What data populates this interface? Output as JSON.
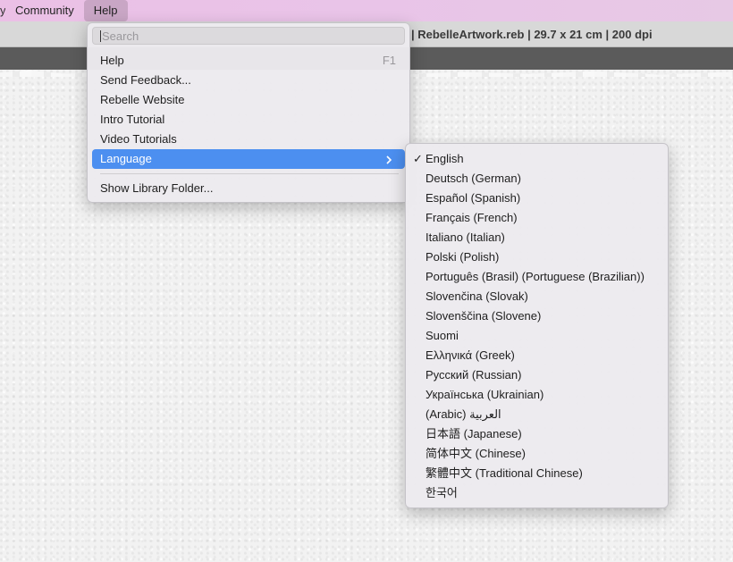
{
  "menubar": {
    "items": [
      {
        "label": "Community"
      },
      {
        "label": "Help"
      }
    ]
  },
  "window": {
    "title": "| RebelleArtwork.reb | 29.7 x 21 cm | 200 dpi"
  },
  "help_menu": {
    "search_placeholder": "Search",
    "items": [
      {
        "label": "Help",
        "shortcut": "F1"
      },
      {
        "label": "Send Feedback..."
      },
      {
        "label": "Rebelle Website"
      },
      {
        "label": "Intro Tutorial"
      },
      {
        "label": "Video Tutorials"
      },
      {
        "label": "Language",
        "submenu_icon": "chevron-right-icon"
      },
      {
        "label": "Show Library Folder..."
      }
    ]
  },
  "language_menu": {
    "checked_icon": "checkmark-icon",
    "items": [
      {
        "label": "English",
        "checked": true
      },
      {
        "label": "Deutsch (German)"
      },
      {
        "label": "Español (Spanish)"
      },
      {
        "label": "Français (French)"
      },
      {
        "label": "Italiano (Italian)"
      },
      {
        "label": "Polski (Polish)"
      },
      {
        "label": "Português (Brasil) (Portuguese (Brazilian))"
      },
      {
        "label": "Slovenčina (Slovak)"
      },
      {
        "label": "Slovenščina (Slovene)"
      },
      {
        "label": "Suomi"
      },
      {
        "label": "Ελληνικά (Greek)"
      },
      {
        "label": "Русский (Russian)"
      },
      {
        "label": "Українська (Ukrainian)"
      },
      {
        "label": "(Arabic) العربية"
      },
      {
        "label": "日本語 (Japanese)"
      },
      {
        "label": "简体中文 (Chinese)"
      },
      {
        "label": "繁體中文 (Traditional Chinese)"
      },
      {
        "label": "한국어"
      }
    ]
  },
  "colors": {
    "selection": "#4c8ff0",
    "menubar": "#ebc0e6"
  }
}
